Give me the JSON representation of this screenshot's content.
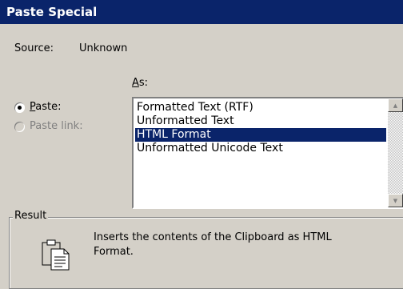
{
  "window": {
    "title": "Paste Special"
  },
  "source": {
    "label": "Source:",
    "value": "Unknown"
  },
  "as_label": "As:",
  "options": {
    "paste": {
      "label": "Paste:",
      "selected": true
    },
    "paste_link": {
      "label": "Paste link:",
      "enabled": false
    }
  },
  "formats": {
    "items": [
      "Formatted Text (RTF)",
      "Unformatted Text",
      "HTML Format",
      "Unformatted Unicode Text"
    ],
    "selected_index": 2
  },
  "result": {
    "label": "Result",
    "text_line1": "Inserts the contents of the Clipboard as HTML",
    "text_line2": "Format.",
    "icon": "clipboard-document-icon"
  },
  "colors": {
    "titlebar": "#0a246a",
    "selection": "#0a246a",
    "face": "#d4d0c8",
    "disabled_text": "#808080"
  }
}
